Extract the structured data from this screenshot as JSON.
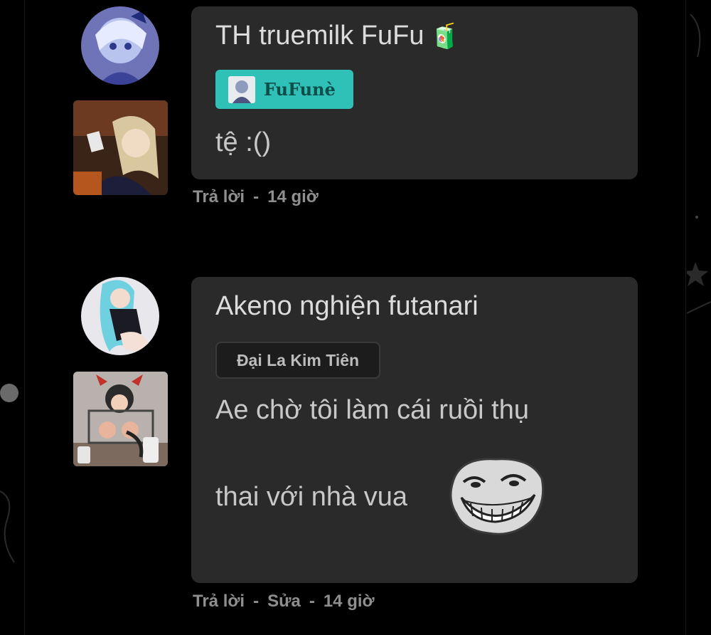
{
  "comments": [
    {
      "author": "TH truemilk FuFu",
      "author_emoji": "🧃",
      "badge": "FuFunè",
      "content_lines": [
        "tệ :()"
      ],
      "actions": [
        "Trả lời"
      ],
      "time": "14 giờ",
      "badge_style": "teal",
      "badge_color": "#2fc0b8"
    },
    {
      "author": "Akeno nghiện futanari",
      "badge": "Đại La Kim Tiên",
      "content_lines": [
        "Ae chờ tôi làm cái ruồi thụ",
        "thai với nhà vua"
      ],
      "inline_image": "trollface-meme",
      "actions": [
        "Trả lời",
        "Sửa"
      ],
      "time": "14 giờ",
      "badge_style": "dark"
    }
  ],
  "colors": {
    "background": "#000000",
    "bubble": "#2a2a2a",
    "author_text": "#dcdcdc",
    "content_text": "#c8c8c8",
    "meta_text": "#8f8f8f",
    "teal_badge": "#2fc0b8"
  },
  "separator": "-"
}
